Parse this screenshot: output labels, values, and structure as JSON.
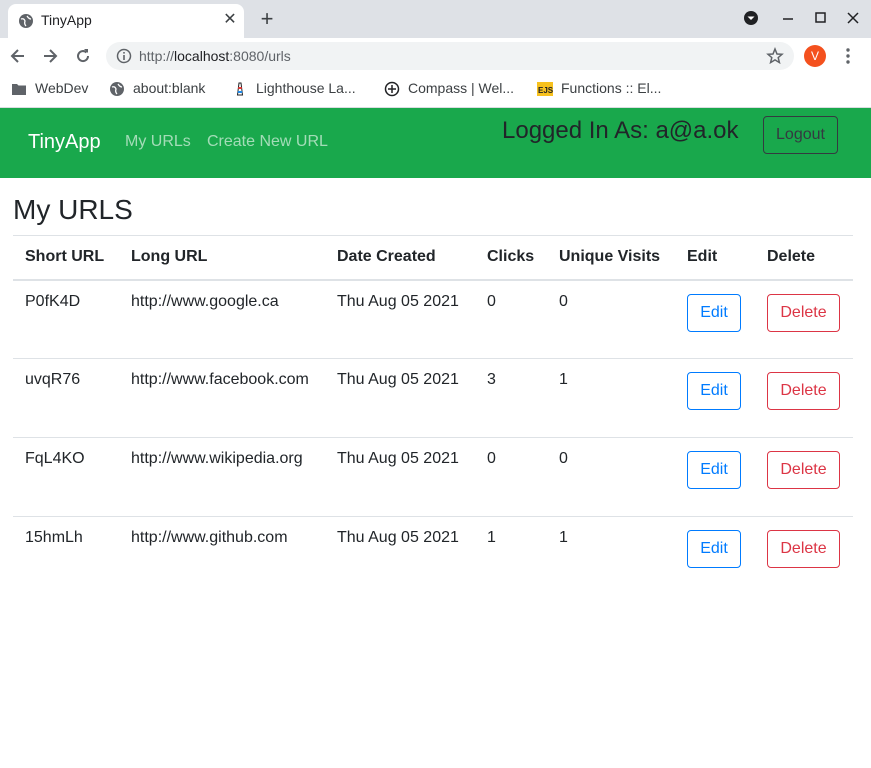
{
  "browser": {
    "tab_title": "TinyApp",
    "url_scheme": "http://",
    "url_host": "localhost",
    "url_rest": ":8080/urls",
    "profile_initial": "V",
    "bookmarks": [
      {
        "label": "WebDev",
        "icon": "folder-icon"
      },
      {
        "label": "about:blank",
        "icon": "globe-icon"
      },
      {
        "label": "Lighthouse La...",
        "icon": "lighthouse-icon"
      },
      {
        "label": "Compass | Wel...",
        "icon": "compass-icon"
      },
      {
        "label": "Functions :: El...",
        "icon": "ejs-icon"
      }
    ]
  },
  "navbar": {
    "brand": "TinyApp",
    "links": [
      "My URLs",
      "Create New URL"
    ],
    "logged_in_text": "Logged In As: a@a.ok",
    "logout_label": "Logout"
  },
  "page": {
    "title": "My URLS"
  },
  "table": {
    "headers": [
      "Short URL",
      "Long URL",
      "Date Created",
      "Clicks",
      "Unique Visits",
      "Edit",
      "Delete"
    ],
    "rows": [
      {
        "short": "P0fK4D",
        "long": "http://www.google.ca",
        "date": "Thu Aug 05 2021",
        "clicks": "0",
        "unique": "0",
        "edit": "Edit",
        "delete": "Delete"
      },
      {
        "short": "uvqR76",
        "long": "http://www.facebook.com",
        "date": "Thu Aug 05 2021",
        "clicks": "3",
        "unique": "1",
        "edit": "Edit",
        "delete": "Delete"
      },
      {
        "short": "FqL4KO",
        "long": "http://www.wikipedia.org",
        "date": "Thu Aug 05 2021",
        "clicks": "0",
        "unique": "0",
        "edit": "Edit",
        "delete": "Delete"
      },
      {
        "short": "15hmLh",
        "long": "http://www.github.com",
        "date": "Thu Aug 05 2021",
        "clicks": "1",
        "unique": "1",
        "edit": "Edit",
        "delete": "Delete"
      }
    ]
  },
  "colors": {
    "navbar_bg": "#19a84c",
    "edit_blue": "#007bff",
    "delete_red": "#dc3545"
  }
}
